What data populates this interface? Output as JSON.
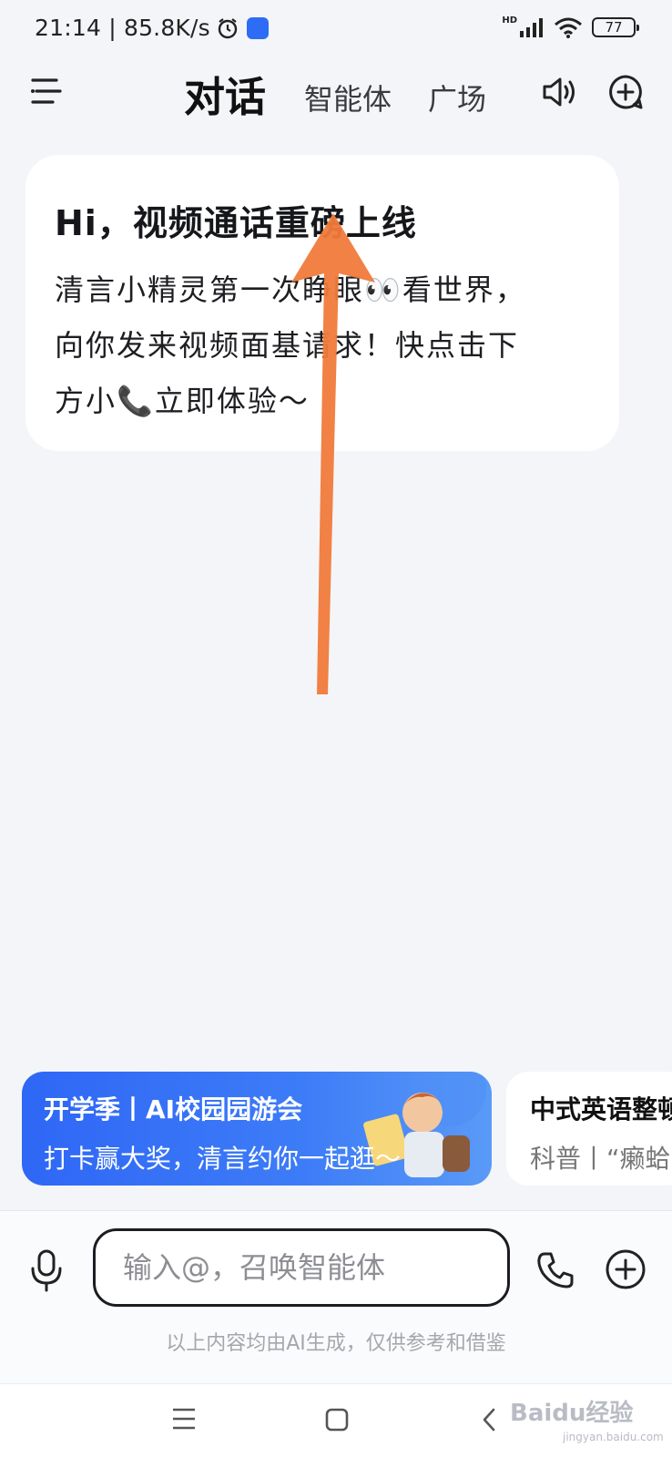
{
  "status_bar": {
    "time_speed": "21:14 | 85.8K/s",
    "network": "HD",
    "battery": "77"
  },
  "header": {
    "tabs": [
      {
        "label": "对话",
        "active": true
      },
      {
        "label": "智能体",
        "active": false
      },
      {
        "label": "广场",
        "active": false
      }
    ]
  },
  "card": {
    "title": "Hi，视频通话重磅上线",
    "lines": [
      "清言小精灵第一次睁眼👀看世界，",
      "向你发来视频面基请求！快点击下",
      "方小📞立即体验～"
    ]
  },
  "banners": [
    {
      "title": "开学季丨AI校园园游会",
      "subtitle": "打卡赢大奖，清言约你一起逛～"
    },
    {
      "title": "中式英语整顿",
      "subtitle": "科普丨“癞蛤"
    }
  ],
  "input": {
    "placeholder": "输入@，召唤智能体"
  },
  "disclaimer": "以上内容均由AI生成，仅供参考和借鉴",
  "watermark": {
    "text": "Baidu经验",
    "sub": "jingyan.baidu.com"
  },
  "colors": {
    "accent_blue": "#2f67f6",
    "annotation_arrow": "#f07a3a",
    "background": "#f4f5f8"
  }
}
